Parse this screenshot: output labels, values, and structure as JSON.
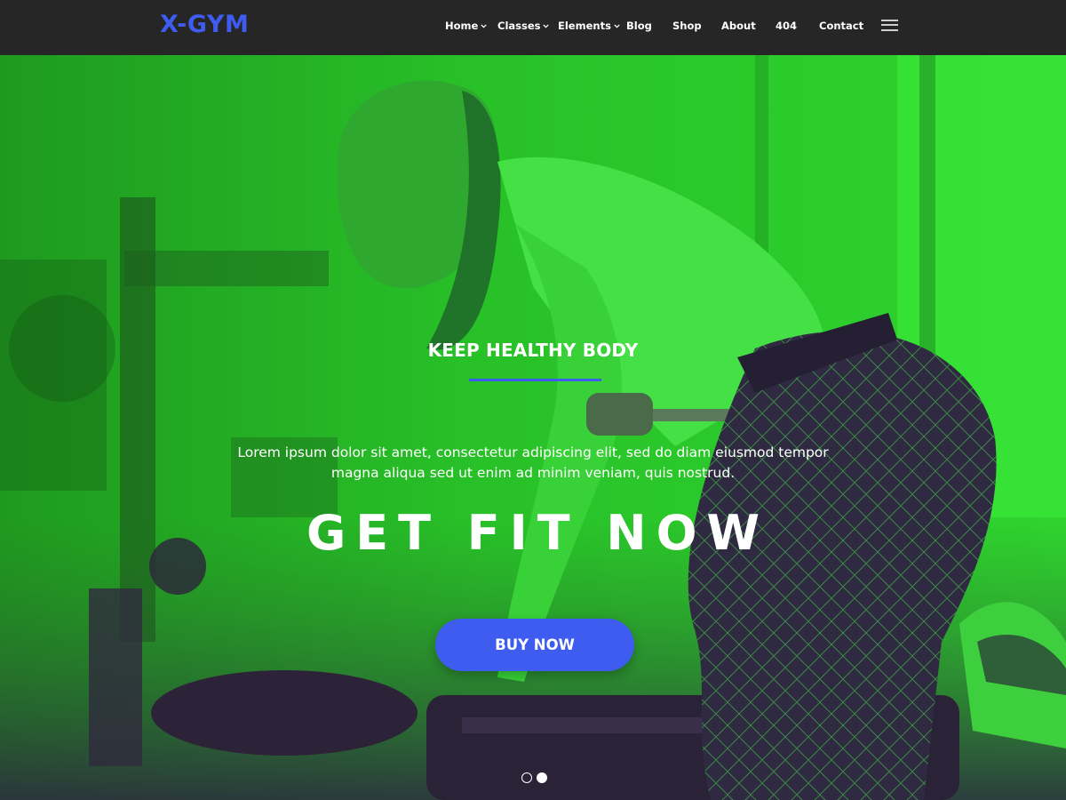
{
  "brand": {
    "logo_text": "X-GYM",
    "accent_color": "#3f5cf0"
  },
  "nav": {
    "items": [
      {
        "label": "Home",
        "has_dropdown": true
      },
      {
        "label": "Classes",
        "has_dropdown": true
      },
      {
        "label": "Elements",
        "has_dropdown": true
      },
      {
        "label": "Blog",
        "has_dropdown": false
      },
      {
        "label": "Shop",
        "has_dropdown": false
      },
      {
        "label": "About",
        "has_dropdown": false
      },
      {
        "label": "404",
        "has_dropdown": false
      },
      {
        "label": "Contact",
        "has_dropdown": false
      }
    ],
    "menu_icon": "hamburger-menu-icon"
  },
  "hero": {
    "kicker": "KEEP HEALTHY BODY",
    "description": "Lorem ipsum dolor sit amet, consectetur adipiscing elit, sed do diam eiusmod tempor magna aliqua sed ut enim ad minim veniam, quis nostrud.",
    "title": "GET FIT NOW",
    "cta_label": "BUY NOW",
    "overlay_color": "#21b121",
    "slides": {
      "count": 2,
      "active": 2
    }
  }
}
